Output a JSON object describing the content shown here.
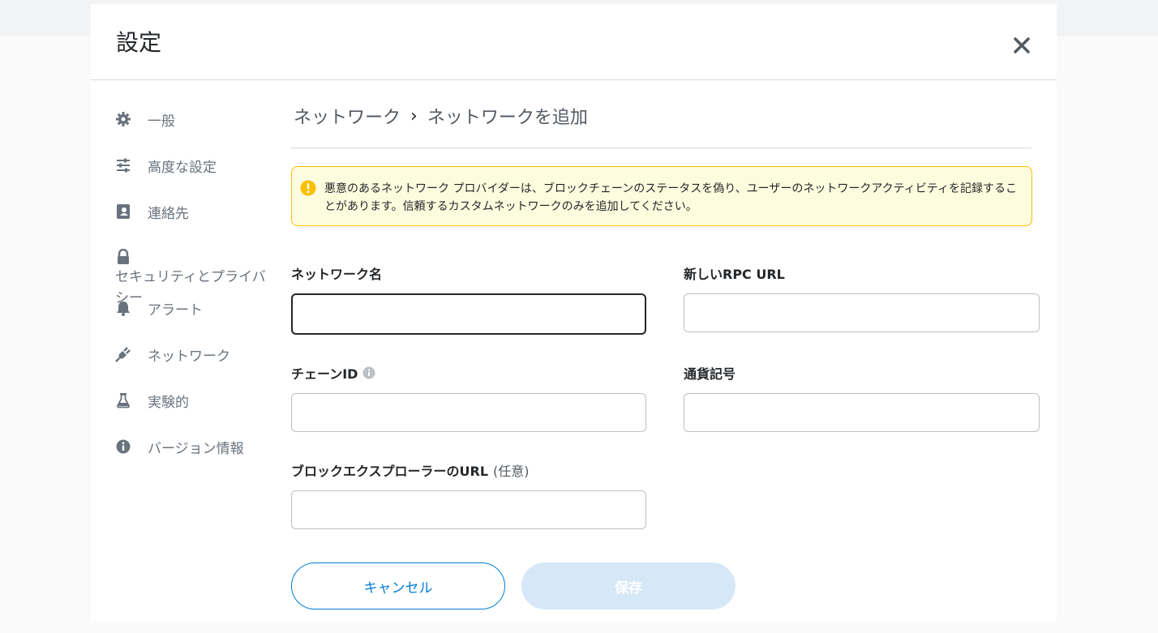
{
  "modal": {
    "title": "設定"
  },
  "sidebar": {
    "items": [
      {
        "label": "一般",
        "icon": "gear-icon"
      },
      {
        "label": "高度な設定",
        "icon": "sliders-icon"
      },
      {
        "label": "連絡先",
        "icon": "contact-book-icon"
      },
      {
        "label": "セキュリティとプライバシー",
        "icon": "lock-icon"
      },
      {
        "label": "アラート",
        "icon": "bell-icon"
      },
      {
        "label": "ネットワーク",
        "icon": "plug-icon"
      },
      {
        "label": "実験的",
        "icon": "flask-icon"
      },
      {
        "label": "バージョン情報",
        "icon": "info-circle-icon"
      }
    ]
  },
  "breadcrumb": {
    "parent": "ネットワーク",
    "separator": "›",
    "current": "ネットワークを追加"
  },
  "warning": {
    "text": "悪意のあるネットワーク プロバイダーは、ブロックチェーンのステータスを偽り、ユーザーのネットワークアクティビティを記録することがあります。信頼するカスタムネットワークのみを追加してください。"
  },
  "form": {
    "network_name": {
      "label": "ネットワーク名",
      "value": "",
      "placeholder": ""
    },
    "rpc_url": {
      "label": "新しいRPC URL",
      "value": "",
      "placeholder": ""
    },
    "chain_id": {
      "label": "チェーンID",
      "value": "",
      "placeholder": ""
    },
    "currency_symbol": {
      "label": "通貨記号",
      "value": "",
      "placeholder": ""
    },
    "explorer_url": {
      "label": "ブロックエクスプローラーのURL",
      "optional": "(任意)",
      "value": "",
      "placeholder": ""
    }
  },
  "buttons": {
    "cancel": "キャンセル",
    "save": "保存"
  },
  "colors": {
    "accent": "#037dd6",
    "save_disabled_bg": "#d6e8f7",
    "warning_bg": "#fefcde",
    "warning_border": "#f8c000",
    "text_muted": "#6a737d"
  }
}
